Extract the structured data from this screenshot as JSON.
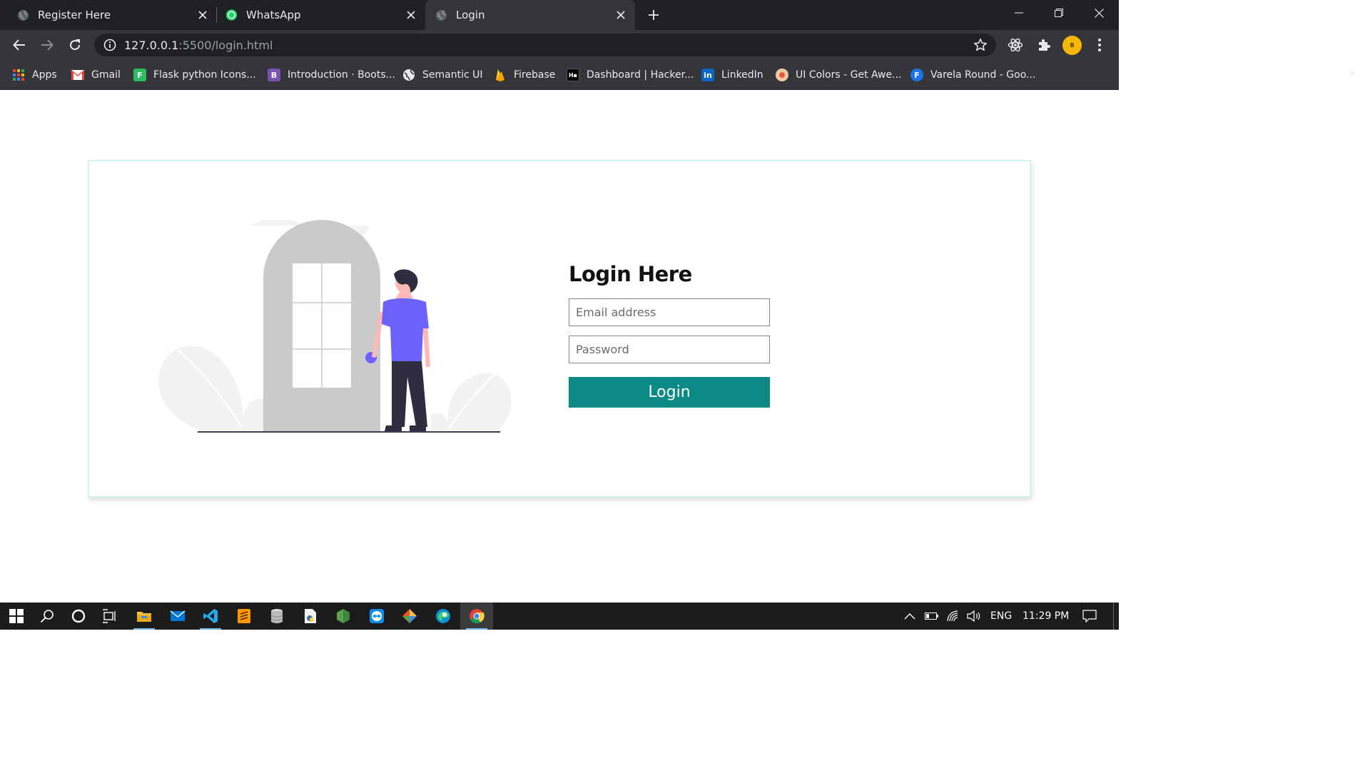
{
  "browser": {
    "tabs": [
      {
        "title": "Register Here",
        "favicon": "globe-icon",
        "active": false
      },
      {
        "title": "WhatsApp",
        "favicon": "whatsapp-icon",
        "active": false
      },
      {
        "title": "Login",
        "favicon": "globe-icon",
        "active": true
      }
    ],
    "address": {
      "host": "127.0.0.1",
      "path": ":5500/login.html"
    },
    "bookmarks": [
      {
        "label": "Apps",
        "icon": "apps-grid-icon"
      },
      {
        "label": "Gmail",
        "icon": "gmail-icon"
      },
      {
        "label": "Flask python Icons...",
        "icon": "flask-icons-icon"
      },
      {
        "label": "Introduction · Boots...",
        "icon": "bootstrap-icon"
      },
      {
        "label": "Semantic UI",
        "icon": "semantic-ui-icon"
      },
      {
        "label": "Firebase",
        "icon": "firebase-icon"
      },
      {
        "label": "Dashboard | Hacker...",
        "icon": "hackerrank-icon"
      },
      {
        "label": "LinkedIn",
        "icon": "linkedin-icon"
      },
      {
        "label": "UI Colors - Get Awe...",
        "icon": "ui-colors-icon"
      },
      {
        "label": "Varela Round - Goo...",
        "icon": "google-fonts-icon"
      }
    ],
    "bookmarks_more": "»",
    "profile_initials": "B"
  },
  "login": {
    "title": "Login Here",
    "email_placeholder": "Email address",
    "password_placeholder": "Password",
    "button_label": "Login"
  },
  "colors": {
    "accent": "#0b8a86",
    "card_border": "#d4f2f4",
    "illustration_purple": "#6c63ff"
  },
  "taskbar": {
    "language": "ENG",
    "time": "11:29 PM"
  }
}
